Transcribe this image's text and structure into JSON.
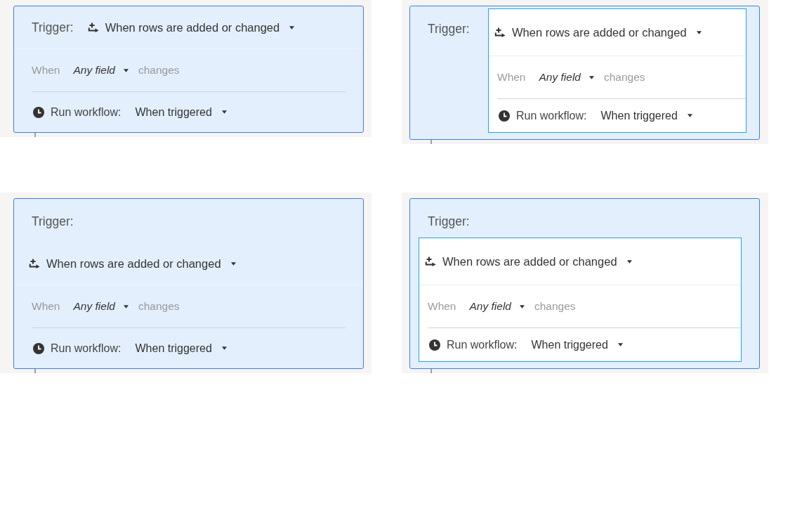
{
  "panels": [
    {
      "kind": "inline",
      "highlighted": false,
      "trigger_label": "Trigger:",
      "trigger_value": "When rows are added or changed",
      "condition": {
        "prefix": "When",
        "field": "Any field",
        "suffix": "changes"
      },
      "run": {
        "label": "Run workflow:",
        "value": "When triggered"
      }
    },
    {
      "kind": "inline",
      "highlighted": true,
      "trigger_label": "Trigger:",
      "trigger_value": "When rows are added or changed",
      "condition": {
        "prefix": "When",
        "field": "Any field",
        "suffix": "changes"
      },
      "run": {
        "label": "Run workflow:",
        "value": "When triggered"
      }
    },
    {
      "kind": "stacked",
      "highlighted": false,
      "trigger_label": "Trigger:",
      "trigger_value": "When rows are added or changed",
      "condition": {
        "prefix": "When",
        "field": "Any field",
        "suffix": "changes"
      },
      "run": {
        "label": "Run workflow:",
        "value": "When triggered"
      }
    },
    {
      "kind": "stacked",
      "highlighted": true,
      "trigger_label": "Trigger:",
      "trigger_value": "When rows are added or changed",
      "condition": {
        "prefix": "When",
        "field": "Any field",
        "suffix": "changes"
      },
      "run": {
        "label": "Run workflow:",
        "value": "When triggered"
      }
    }
  ]
}
